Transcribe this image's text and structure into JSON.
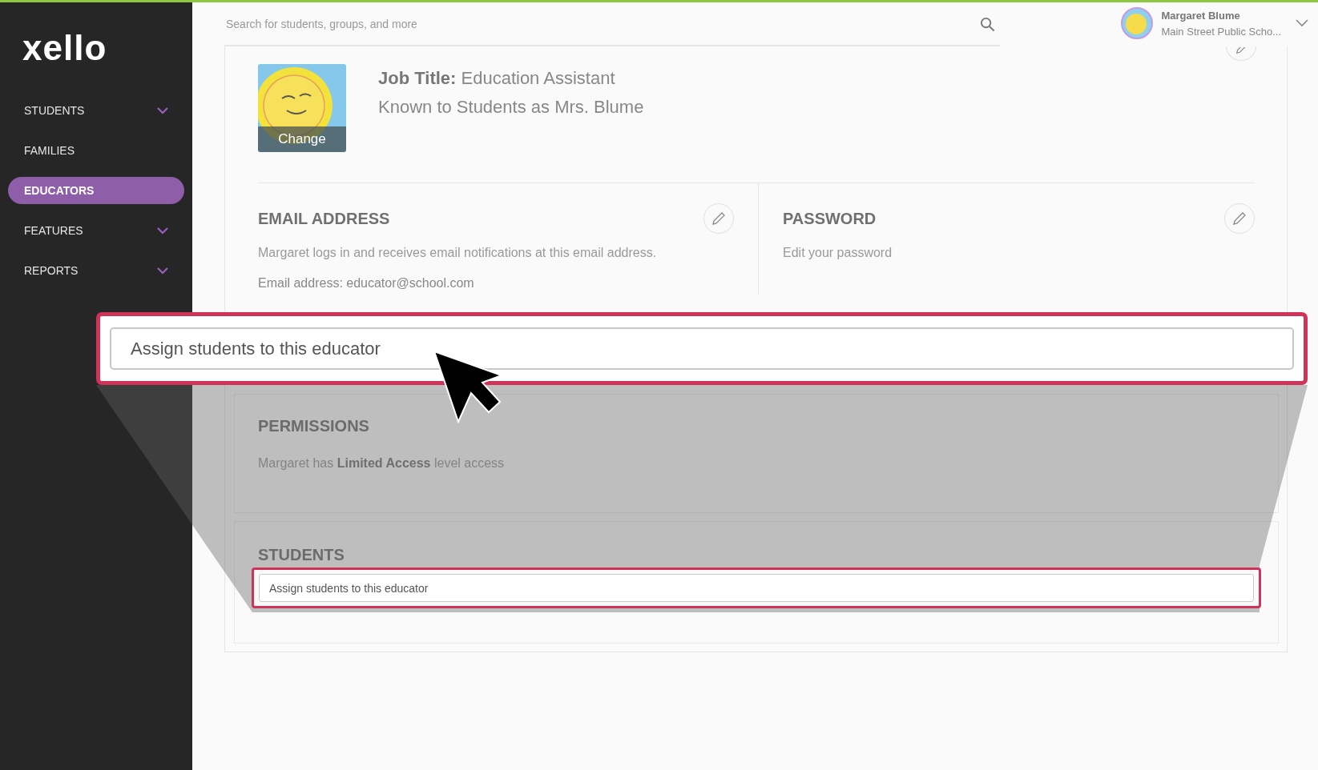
{
  "top_bar": {
    "search": {
      "placeholder": "Search for students, groups, and more"
    },
    "user": {
      "name": "Margaret Blume",
      "school": "Main Street Public Scho..."
    }
  },
  "sidebar": {
    "logo": "xello",
    "items": [
      {
        "label": "STUDENTS",
        "selected": false,
        "expandable": true
      },
      {
        "label": "FAMILIES",
        "selected": false,
        "expandable": false
      },
      {
        "label": "EDUCATORS",
        "selected": true,
        "expandable": false
      },
      {
        "label": "FEATURES",
        "selected": false,
        "expandable": true
      },
      {
        "label": "REPORTS",
        "selected": false,
        "expandable": true
      }
    ]
  },
  "profile": {
    "photo_button": "Change",
    "job_title_label": "Job Title:",
    "job_title": "Education Assistant",
    "known_as": "Known to Students as Mrs. Blume"
  },
  "email": {
    "title": "EMAIL ADDRESS",
    "description": "Margaret logs in and receives email notifications at this email address.",
    "address": "Email address: educator@school.com"
  },
  "password": {
    "title": "PASSWORD",
    "description": "Edit your password"
  },
  "permissions": {
    "title": "PERMISSIONS",
    "text": "Margaret has **Limited Access** level access"
  },
  "students": {
    "title": "STUDENTS",
    "field": {
      "placeholder": "Assign students to this educator"
    }
  },
  "callout": {
    "field": {
      "placeholder": "Assign students to this educator"
    }
  }
}
